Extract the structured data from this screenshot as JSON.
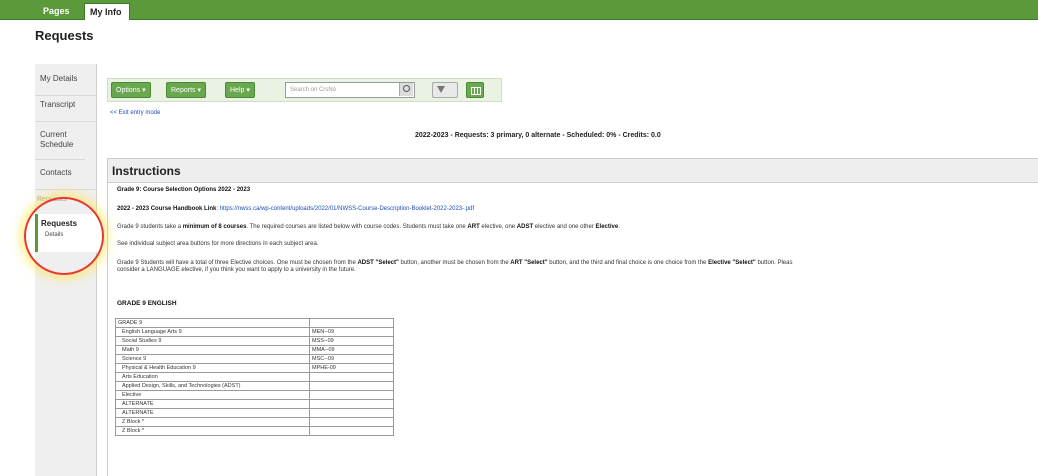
{
  "nav": {
    "tab_pages": "Pages",
    "tab_myinfo": "My Info"
  },
  "page_title": "Requests",
  "sidebar": {
    "items": [
      "My Details",
      "Transcript",
      "Current Schedule",
      "Contacts"
    ],
    "faded_label": "Requests",
    "active_label": "Requests",
    "active_sub": "Details"
  },
  "toolbar": {
    "options": "Options ▾",
    "reports": "Reports ▾",
    "help": "Help ▾",
    "search_placeholder": "Search on CrsNo"
  },
  "exit_link": "<< Exit entry mode",
  "summary": "2022-2023 - Requests: 3 primary, 0 alternate - Scheduled: 0% - Credits: 0.0",
  "instructions": {
    "heading": "Instructions",
    "title": "Grade 9: Course Selection Options 2022 - 2023",
    "handbook_label": "2022 - 2023 Course Handbook Link",
    "handbook_url": "https://nwss.ca/wp-content/uploads/2022/01/NWSS-Course-Description-Booklet-2022-2023-.pdf",
    "p1_a": "Grade 9 students take a ",
    "p1_bold1": "minimum of 8 courses",
    "p1_b": ". The required courses are listed below with course codes. Students must take one ",
    "p1_bold2": "ART",
    "p1_c": " elective, one ",
    "p1_bold3": "ADST",
    "p1_d": " elective and one other ",
    "p1_bold4": "Elective",
    "p1_e": ".",
    "p2": "See individual subject area buttons for more directions in each subject area.",
    "p3_a": "Grade 9 Students will have a total of three Elective choices. One must be chosen from the ",
    "p3_bold1": "ADST \"Select\"",
    "p3_b": " button, another must be chosen from the ",
    "p3_bold2": "ART \"Select\"",
    "p3_c": " button, and the third and final choice is one choice from the ",
    "p3_bold3": "Elective \"Select\"",
    "p3_d": " button.  Pleas",
    "p3_line2": "consider a LANGUAGE elective, if you think you want to apply to a university in the future.",
    "section": "GRADE 9 ENGLISH"
  },
  "table": {
    "header": "GRADE 9",
    "rows": [
      {
        "course": "English Language Arts 9",
        "code": "MEN--09"
      },
      {
        "course": "Social Studies 9",
        "code": "MSS--09"
      },
      {
        "course": "Math 9",
        "code": "MMA--09"
      },
      {
        "course": "Science 9",
        "code": "MSC--09"
      },
      {
        "course": "Physical & Health Education 9",
        "code": "MPHE-09"
      },
      {
        "course": "Arts Education",
        "code": ""
      },
      {
        "course": "Applied Design, Skills, and  Technologies (ADST)",
        "code": ""
      },
      {
        "course": "Elective",
        "code": ""
      },
      {
        "course": "ALTERNATE",
        "code": ""
      },
      {
        "course": "ALTERNATE",
        "code": ""
      },
      {
        "course": "Z Block *",
        "code": ""
      },
      {
        "course": "Z Block *",
        "code": ""
      }
    ]
  },
  "colors": {
    "nav_green": "#5a9a3a",
    "button_green": "#6aa84f",
    "highlight_red": "#e8392f",
    "link_blue": "#1a4fb8"
  }
}
